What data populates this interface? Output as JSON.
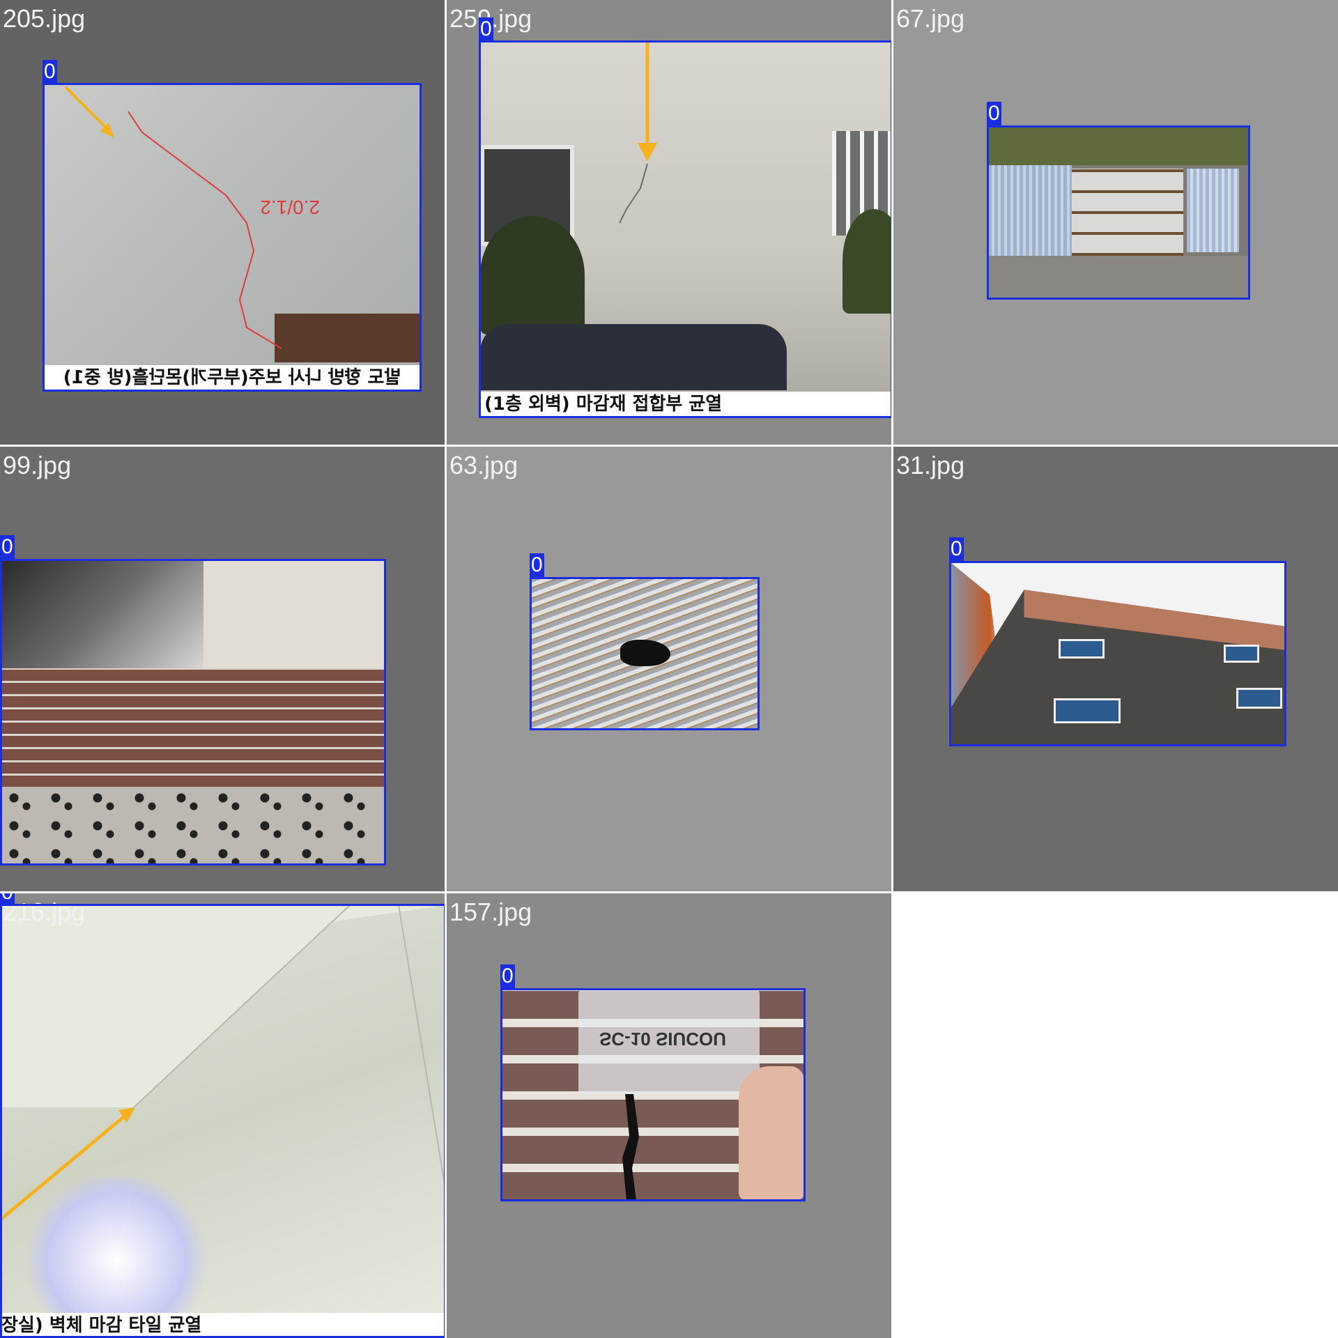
{
  "tiles": [
    {
      "filename": "205.jpg",
      "class_label": "0",
      "caption": "발도 향방 나사 보주(부두개)몬단흘(방 중1)",
      "annotation": "2.0/1.2"
    },
    {
      "filename": "259.jpg",
      "class_label": "0",
      "caption": "(1층 외벽) 마감재 접합부 균열"
    },
    {
      "filename": "67.jpg",
      "class_label": "0"
    },
    {
      "filename": "99.jpg",
      "class_label": "0"
    },
    {
      "filename": "63.jpg",
      "class_label": "0"
    },
    {
      "filename": "31.jpg",
      "class_label": "0"
    },
    {
      "filename": "216.jpg",
      "class_label": "0",
      "caption": "장실) 벽체 마감 타일 균열"
    },
    {
      "filename": "157.jpg",
      "class_label": "0",
      "gauge_text": "SC-10  SIUCOU"
    }
  ],
  "colors": {
    "bbox": "#1a2ee0",
    "label_bg": "#1a2ee0",
    "label_text": "#ffffff",
    "filename_text": "#f2f2f2",
    "arrow": "#f5b21c",
    "crack_mark": "#e03a3a"
  }
}
